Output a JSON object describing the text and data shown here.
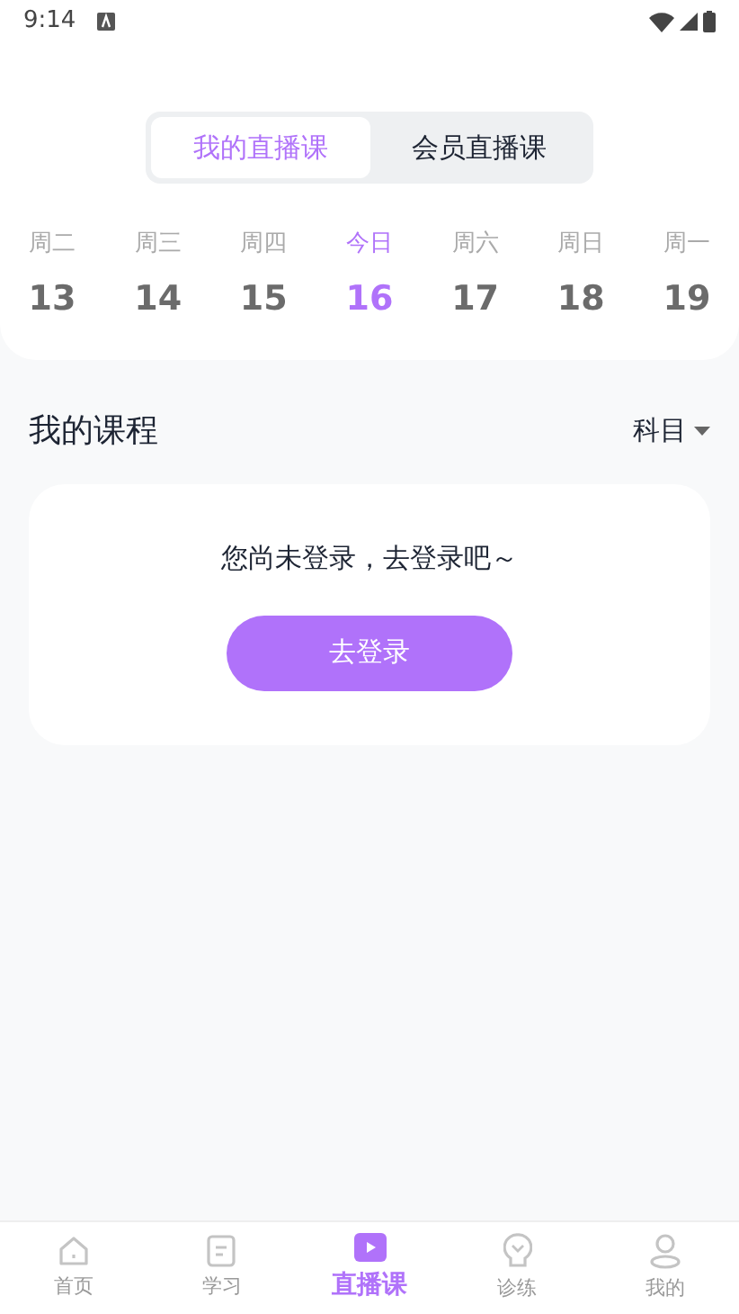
{
  "status_bar": {
    "time": "9:14"
  },
  "tabs": [
    {
      "label": "我的直播课",
      "selected": true
    },
    {
      "label": "会员直播课",
      "selected": false
    }
  ],
  "days": [
    {
      "weekday": "周二",
      "date": "13",
      "selected": false
    },
    {
      "weekday": "周三",
      "date": "14",
      "selected": false
    },
    {
      "weekday": "周四",
      "date": "15",
      "selected": false
    },
    {
      "weekday": "今日",
      "date": "16",
      "selected": true
    },
    {
      "weekday": "周六",
      "date": "17",
      "selected": false
    },
    {
      "weekday": "周日",
      "date": "18",
      "selected": false
    },
    {
      "weekday": "周一",
      "date": "19",
      "selected": false
    }
  ],
  "section": {
    "title": "我的课程",
    "filter": "科目"
  },
  "login_card": {
    "message": "您尚未登录，去登录吧～",
    "button": "去登录"
  },
  "bottom_nav": [
    {
      "label": "首页",
      "kind": "home",
      "selected": false
    },
    {
      "label": "学习",
      "kind": "study",
      "selected": false
    },
    {
      "label": "直播课",
      "kind": "live",
      "selected": true
    },
    {
      "label": "诊练",
      "kind": "practice",
      "selected": false
    },
    {
      "label": "我的",
      "kind": "profile",
      "selected": false
    }
  ]
}
